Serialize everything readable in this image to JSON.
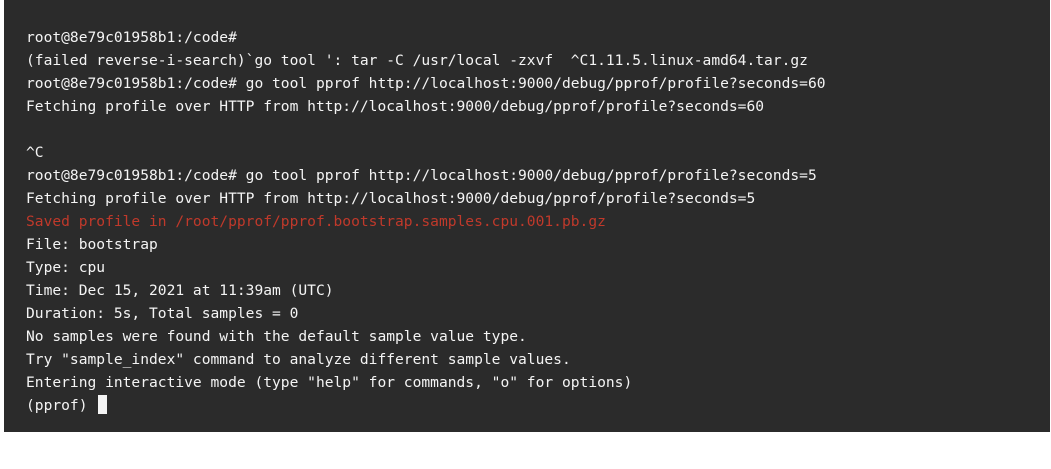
{
  "terminal": {
    "error_color": "#c0392b",
    "text_color": "#f4f4f4",
    "background_color": "#2b2b2b",
    "lines": [
      "root@8e79c01958b1:/code#",
      "(failed reverse-i-search)`go tool ': tar -C /usr/local -zxvf  ^C1.11.5.linux-amd64.tar.gz",
      "root@8e79c01958b1:/code# go tool pprof http://localhost:9000/debug/pprof/profile?seconds=60",
      "Fetching profile over HTTP from http://localhost:9000/debug/pprof/profile?seconds=60",
      "",
      "^C",
      "root@8e79c01958b1:/code# go tool pprof http://localhost:9000/debug/pprof/profile?seconds=5",
      "Fetching profile over HTTP from http://localhost:9000/debug/pprof/profile?seconds=5",
      "Saved profile in /root/pprof/pprof.bootstrap.samples.cpu.001.pb.gz",
      "File: bootstrap",
      "Type: cpu",
      "Time: Dec 15, 2021 at 11:39am (UTC)",
      "Duration: 5s, Total samples = 0",
      "No samples were found with the default sample value type.",
      "Try \"sample_index\" command to analyze different sample values.",
      "Entering interactive mode (type \"help\" for commands, \"o\" for options)"
    ],
    "prompt": "(pprof) "
  }
}
